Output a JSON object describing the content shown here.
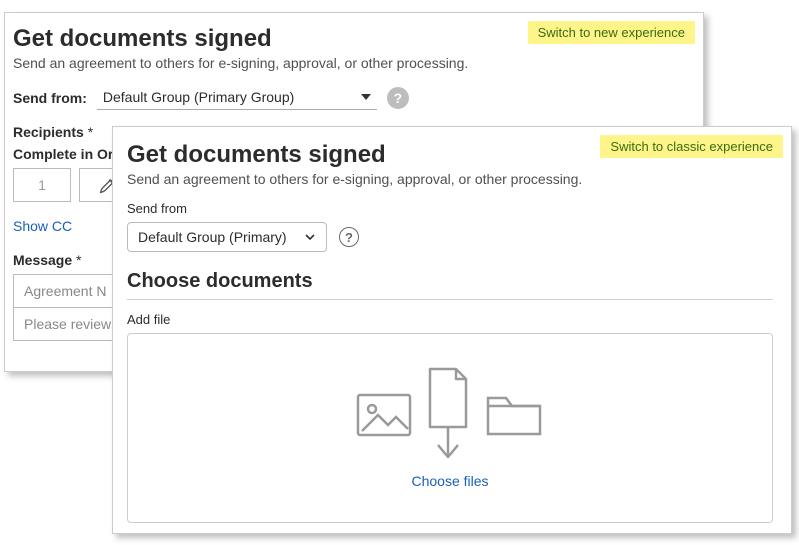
{
  "classic": {
    "switch_label": "Switch to new experience",
    "title": "Get documents signed",
    "subtitle": "Send an agreement to others for e-signing, approval, or other processing.",
    "send_from_label": "Send from:",
    "send_from_value": "Default Group (Primary Group)",
    "help_glyph": "?",
    "recipients_label": "Recipients",
    "complete_order_label": "Complete in Ord",
    "order_value": "1",
    "show_cc_label": "Show CC",
    "message_label": "Message",
    "agreement_placeholder": "Agreement N",
    "review_placeholder": "Please review a"
  },
  "new": {
    "switch_label": "Switch to classic experience",
    "title": "Get documents signed",
    "subtitle": "Send an agreement to others for e-signing, approval, or other processing.",
    "send_from_label": "Send from",
    "send_from_value": "Default Group (Primary)",
    "help_glyph": "?",
    "choose_docs_label": "Choose documents",
    "add_file_label": "Add file",
    "choose_files_label": "Choose files"
  }
}
